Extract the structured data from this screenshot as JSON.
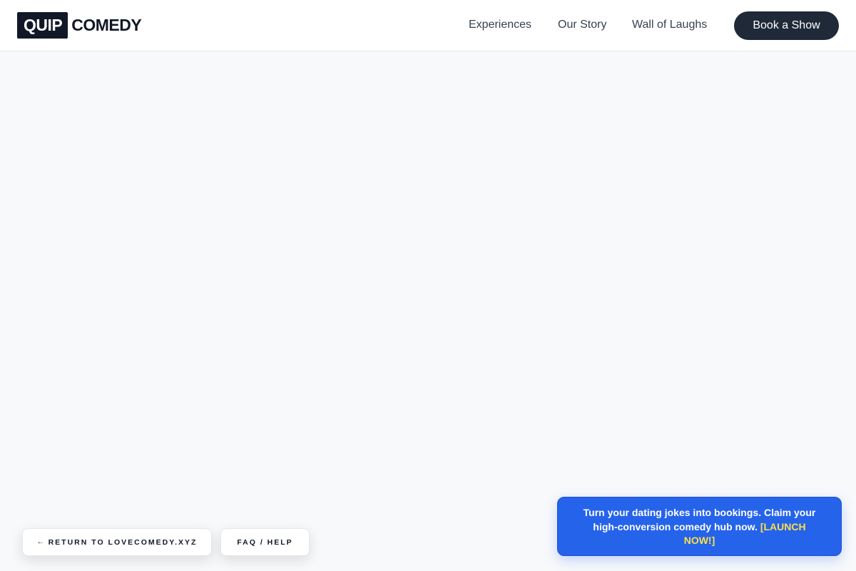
{
  "header": {
    "logo_box": "QUIP",
    "logo_text": "COMEDY",
    "nav": [
      "Experiences",
      "Our Story",
      "Wall of Laughs"
    ],
    "cta": "Book a Show"
  },
  "footer": {
    "return_arrow": "←",
    "return_label": "RETURN TO LOVECOMEDY.XYZ",
    "faq_label": "FAQ / HELP"
  },
  "promo": {
    "text": "Turn your dating jokes into bookings. Claim your high-conversion comedy hub now.",
    "cta": "[LAUNCH NOW!]"
  },
  "colors": {
    "brand_dark": "#111827",
    "button_dark": "#1f2937",
    "promo_blue": "#2563eb",
    "cta_yellow": "#fde047",
    "page_bg": "#f8f9fb"
  }
}
